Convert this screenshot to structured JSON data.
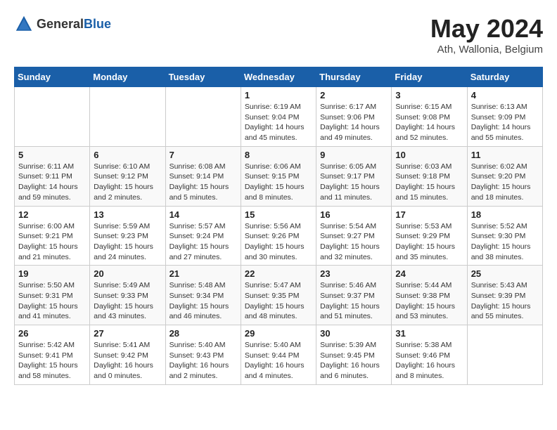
{
  "header": {
    "logo_general": "General",
    "logo_blue": "Blue",
    "month_year": "May 2024",
    "location": "Ath, Wallonia, Belgium"
  },
  "weekdays": [
    "Sunday",
    "Monday",
    "Tuesday",
    "Wednesday",
    "Thursday",
    "Friday",
    "Saturday"
  ],
  "weeks": [
    [
      {
        "day": "",
        "info": ""
      },
      {
        "day": "",
        "info": ""
      },
      {
        "day": "",
        "info": ""
      },
      {
        "day": "1",
        "info": "Sunrise: 6:19 AM\nSunset: 9:04 PM\nDaylight: 14 hours\nand 45 minutes."
      },
      {
        "day": "2",
        "info": "Sunrise: 6:17 AM\nSunset: 9:06 PM\nDaylight: 14 hours\nand 49 minutes."
      },
      {
        "day": "3",
        "info": "Sunrise: 6:15 AM\nSunset: 9:08 PM\nDaylight: 14 hours\nand 52 minutes."
      },
      {
        "day": "4",
        "info": "Sunrise: 6:13 AM\nSunset: 9:09 PM\nDaylight: 14 hours\nand 55 minutes."
      }
    ],
    [
      {
        "day": "5",
        "info": "Sunrise: 6:11 AM\nSunset: 9:11 PM\nDaylight: 14 hours\nand 59 minutes."
      },
      {
        "day": "6",
        "info": "Sunrise: 6:10 AM\nSunset: 9:12 PM\nDaylight: 15 hours\nand 2 minutes."
      },
      {
        "day": "7",
        "info": "Sunrise: 6:08 AM\nSunset: 9:14 PM\nDaylight: 15 hours\nand 5 minutes."
      },
      {
        "day": "8",
        "info": "Sunrise: 6:06 AM\nSunset: 9:15 PM\nDaylight: 15 hours\nand 8 minutes."
      },
      {
        "day": "9",
        "info": "Sunrise: 6:05 AM\nSunset: 9:17 PM\nDaylight: 15 hours\nand 11 minutes."
      },
      {
        "day": "10",
        "info": "Sunrise: 6:03 AM\nSunset: 9:18 PM\nDaylight: 15 hours\nand 15 minutes."
      },
      {
        "day": "11",
        "info": "Sunrise: 6:02 AM\nSunset: 9:20 PM\nDaylight: 15 hours\nand 18 minutes."
      }
    ],
    [
      {
        "day": "12",
        "info": "Sunrise: 6:00 AM\nSunset: 9:21 PM\nDaylight: 15 hours\nand 21 minutes."
      },
      {
        "day": "13",
        "info": "Sunrise: 5:59 AM\nSunset: 9:23 PM\nDaylight: 15 hours\nand 24 minutes."
      },
      {
        "day": "14",
        "info": "Sunrise: 5:57 AM\nSunset: 9:24 PM\nDaylight: 15 hours\nand 27 minutes."
      },
      {
        "day": "15",
        "info": "Sunrise: 5:56 AM\nSunset: 9:26 PM\nDaylight: 15 hours\nand 30 minutes."
      },
      {
        "day": "16",
        "info": "Sunrise: 5:54 AM\nSunset: 9:27 PM\nDaylight: 15 hours\nand 32 minutes."
      },
      {
        "day": "17",
        "info": "Sunrise: 5:53 AM\nSunset: 9:29 PM\nDaylight: 15 hours\nand 35 minutes."
      },
      {
        "day": "18",
        "info": "Sunrise: 5:52 AM\nSunset: 9:30 PM\nDaylight: 15 hours\nand 38 minutes."
      }
    ],
    [
      {
        "day": "19",
        "info": "Sunrise: 5:50 AM\nSunset: 9:31 PM\nDaylight: 15 hours\nand 41 minutes."
      },
      {
        "day": "20",
        "info": "Sunrise: 5:49 AM\nSunset: 9:33 PM\nDaylight: 15 hours\nand 43 minutes."
      },
      {
        "day": "21",
        "info": "Sunrise: 5:48 AM\nSunset: 9:34 PM\nDaylight: 15 hours\nand 46 minutes."
      },
      {
        "day": "22",
        "info": "Sunrise: 5:47 AM\nSunset: 9:35 PM\nDaylight: 15 hours\nand 48 minutes."
      },
      {
        "day": "23",
        "info": "Sunrise: 5:46 AM\nSunset: 9:37 PM\nDaylight: 15 hours\nand 51 minutes."
      },
      {
        "day": "24",
        "info": "Sunrise: 5:44 AM\nSunset: 9:38 PM\nDaylight: 15 hours\nand 53 minutes."
      },
      {
        "day": "25",
        "info": "Sunrise: 5:43 AM\nSunset: 9:39 PM\nDaylight: 15 hours\nand 55 minutes."
      }
    ],
    [
      {
        "day": "26",
        "info": "Sunrise: 5:42 AM\nSunset: 9:41 PM\nDaylight: 15 hours\nand 58 minutes."
      },
      {
        "day": "27",
        "info": "Sunrise: 5:41 AM\nSunset: 9:42 PM\nDaylight: 16 hours\nand 0 minutes."
      },
      {
        "day": "28",
        "info": "Sunrise: 5:40 AM\nSunset: 9:43 PM\nDaylight: 16 hours\nand 2 minutes."
      },
      {
        "day": "29",
        "info": "Sunrise: 5:40 AM\nSunset: 9:44 PM\nDaylight: 16 hours\nand 4 minutes."
      },
      {
        "day": "30",
        "info": "Sunrise: 5:39 AM\nSunset: 9:45 PM\nDaylight: 16 hours\nand 6 minutes."
      },
      {
        "day": "31",
        "info": "Sunrise: 5:38 AM\nSunset: 9:46 PM\nDaylight: 16 hours\nand 8 minutes."
      },
      {
        "day": "",
        "info": ""
      }
    ]
  ]
}
